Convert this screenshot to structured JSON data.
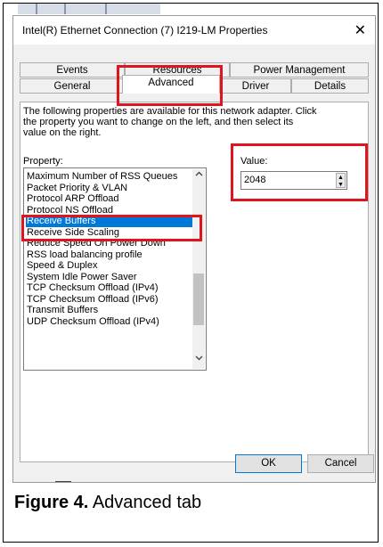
{
  "window": {
    "title": "Intel(R) Ethernet Connection (7) I219-LM Properties",
    "close_glyph": "✕"
  },
  "tabs_top": [
    {
      "label": "Events"
    },
    {
      "label": "Resources"
    },
    {
      "label": "Power Management"
    }
  ],
  "tabs_bottom": [
    {
      "label": "General"
    },
    {
      "label": "Advanced",
      "active": true
    },
    {
      "label": "Driver"
    },
    {
      "label": "Details"
    }
  ],
  "description": "The following properties are available for this network adapter. Click the property you want to change on the left, and then select its value on the right.",
  "property_label": "Property:",
  "value_label": "Value:",
  "properties": [
    {
      "label": "Maximum Number of RSS Queues"
    },
    {
      "label": "Packet Priority & VLAN"
    },
    {
      "label": "Protocol ARP Offload"
    },
    {
      "label": "Protocol NS Offload"
    },
    {
      "label": "Receive Buffers",
      "selected": true
    },
    {
      "label": "Receive Side Scaling"
    },
    {
      "label": "Reduce Speed On Power Down"
    },
    {
      "label": "RSS load balancing profile"
    },
    {
      "label": "Speed & Duplex"
    },
    {
      "label": "System Idle Power Saver"
    },
    {
      "label": "TCP Checksum Offload (IPv4)"
    },
    {
      "label": "TCP Checksum Offload (IPv6)"
    },
    {
      "label": "Transmit Buffers"
    },
    {
      "label": "UDP Checksum Offload (IPv4)"
    }
  ],
  "value": "2048",
  "buttons": {
    "ok": "OK",
    "cancel": "Cancel"
  },
  "caption": {
    "bold": "Figure 4.",
    "text": " Advanced tab"
  },
  "colors": {
    "highlight": "#e0141e",
    "selection": "#0078d7"
  },
  "icons": {
    "scroll_up": "chevron-up-icon",
    "scroll_down": "chevron-down-icon",
    "spin_up": "triangle-up-icon",
    "spin_down": "triangle-down-icon"
  }
}
